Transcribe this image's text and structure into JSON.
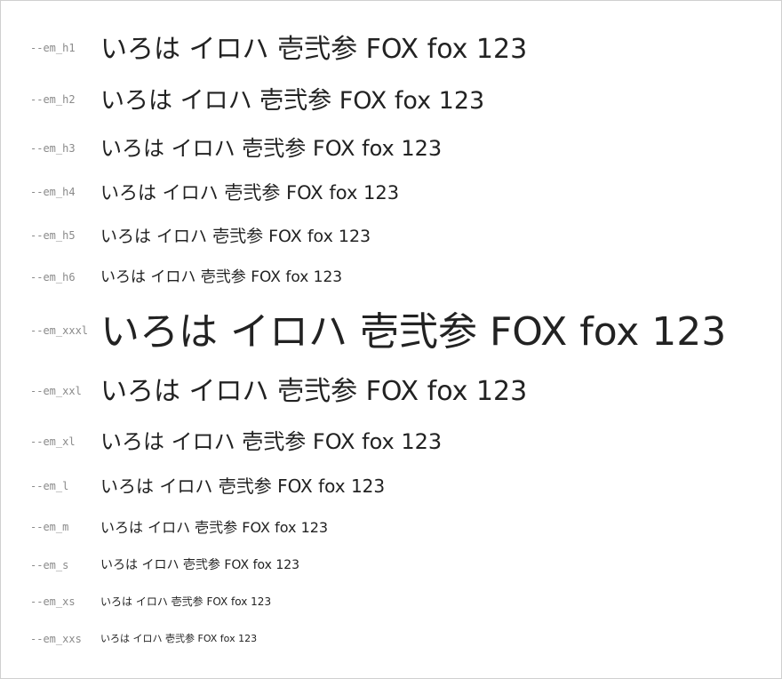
{
  "sample_text": "いろは イロハ 壱弐参 FOX fox 123",
  "rows": [
    {
      "token": "--em_h1"
    },
    {
      "token": "--em_h2"
    },
    {
      "token": "--em_h3"
    },
    {
      "token": "--em_h4"
    },
    {
      "token": "--em_h5"
    },
    {
      "token": "--em_h6"
    },
    {
      "token": "--em_xxxl"
    },
    {
      "token": "--em_xxl"
    },
    {
      "token": "--em_xl"
    },
    {
      "token": "--em_l"
    },
    {
      "token": "--em_m"
    },
    {
      "token": "--em_s"
    },
    {
      "token": "--em_xs"
    },
    {
      "token": "--em_xxs"
    }
  ],
  "colors": {
    "text": "#222222",
    "label": "#8a8a8a",
    "border": "#d0d0d0"
  }
}
